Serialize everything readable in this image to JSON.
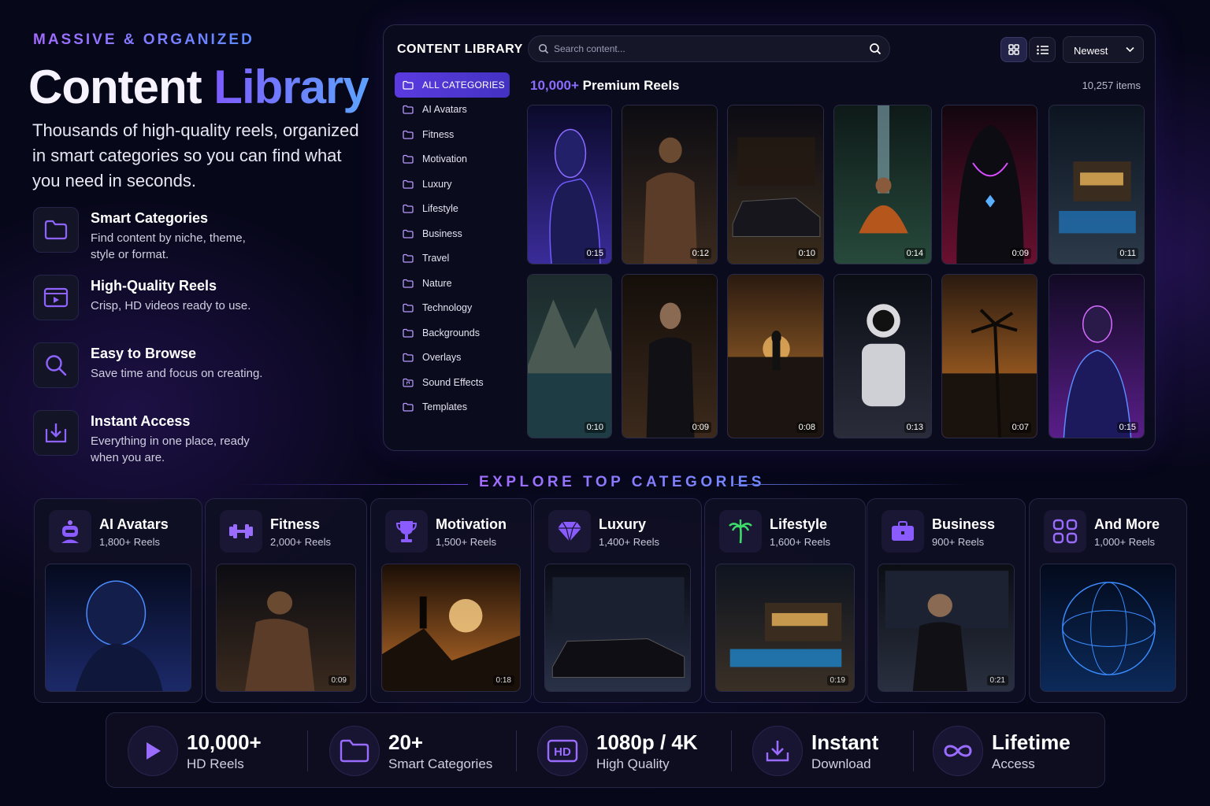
{
  "hero": {
    "eyebrow": "MASSIVE & ORGANIZED",
    "title_part1": "Content",
    "title_part2": "Library",
    "description": "Thousands of high-quality reels, organized in smart categories so you can find what you need in seconds."
  },
  "features": [
    {
      "icon": "folder-icon",
      "title": "Smart Categories",
      "desc": "Find content by niche, theme, style or format."
    },
    {
      "icon": "video-icon",
      "title": "High-Quality Reels",
      "desc": "Crisp, HD videos ready to use."
    },
    {
      "icon": "search-icon",
      "title": "Easy to Browse",
      "desc": "Save time and focus on creating."
    },
    {
      "icon": "download-icon",
      "title": "Instant Access",
      "desc": "Everything in one place, ready when you are."
    }
  ],
  "library": {
    "title": "CONTENT LIBRARY",
    "search_placeholder": "Search content...",
    "sort_value": "Newest",
    "count_number": "10,000+",
    "count_label": "Premium Reels",
    "items_count": "10,257 items",
    "categories": [
      "ALL CATEGORIES",
      "AI Avatars",
      "Fitness",
      "Motivation",
      "Luxury",
      "Lifestyle",
      "Business",
      "Travel",
      "Nature",
      "Technology",
      "Backgrounds",
      "Overlays",
      "Sound Effects",
      "Templates"
    ],
    "active_category": "ALL CATEGORIES",
    "tiles": [
      {
        "subject": "ai-avatar",
        "duration": "0:15"
      },
      {
        "subject": "fitness-man",
        "duration": "0:12"
      },
      {
        "subject": "luxury-car",
        "duration": "0:10"
      },
      {
        "subject": "monk-waterfall",
        "duration": "0:14"
      },
      {
        "subject": "hooded-figure",
        "duration": "0:09"
      },
      {
        "subject": "villa-pool",
        "duration": "0:11"
      },
      {
        "subject": "mountain-lake",
        "duration": "0:10"
      },
      {
        "subject": "businessman",
        "duration": "0:09"
      },
      {
        "subject": "runner-sunset",
        "duration": "0:08"
      },
      {
        "subject": "astronaut",
        "duration": "0:13"
      },
      {
        "subject": "palm-beach",
        "duration": "0:07"
      },
      {
        "subject": "neon-man",
        "duration": "0:15"
      }
    ]
  },
  "explore": {
    "title": "EXPLORE TOP CATEGORIES",
    "cards": [
      {
        "icon": "robot-icon",
        "name": "AI Avatars",
        "count": "1,800+ Reels",
        "duration": ""
      },
      {
        "icon": "dumbbell-icon",
        "name": "Fitness",
        "count": "2,000+ Reels",
        "duration": "0:09"
      },
      {
        "icon": "trophy-icon",
        "name": "Motivation",
        "count": "1,500+ Reels",
        "duration": "0:18"
      },
      {
        "icon": "diamond-icon",
        "name": "Luxury",
        "count": "1,400+ Reels",
        "duration": ""
      },
      {
        "icon": "palm-icon",
        "name": "Lifestyle",
        "count": "1,600+ Reels",
        "duration": "0:19"
      },
      {
        "icon": "briefcase-icon",
        "name": "Business",
        "count": "900+ Reels",
        "duration": "0:21"
      },
      {
        "icon": "grid-icon",
        "name": "And More",
        "count": "1,000+ Reels",
        "duration": ""
      }
    ]
  },
  "stats": [
    {
      "icon": "play-icon",
      "value": "10,000+",
      "label": "HD Reels"
    },
    {
      "icon": "folder-icon",
      "value": "20+",
      "label": "Smart Categories"
    },
    {
      "icon": "hd-icon",
      "value": "1080p / 4K",
      "label": "High Quality"
    },
    {
      "icon": "download-icon",
      "value": "Instant",
      "label": "Download"
    },
    {
      "icon": "infinity-icon",
      "value": "Lifetime",
      "label": "Access"
    }
  ],
  "colors": {
    "accent": "#7c5cff",
    "accent_blue": "#5ea4ff",
    "background": "#07071a"
  }
}
